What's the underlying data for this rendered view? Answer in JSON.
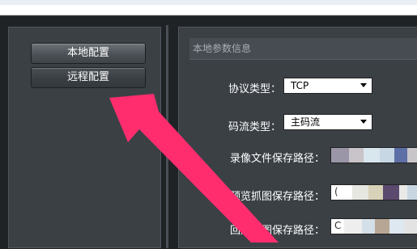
{
  "left_nav": {
    "items": [
      {
        "label": "本地配置"
      },
      {
        "label": "远程配置"
      }
    ]
  },
  "section": {
    "title": "本地参数信息"
  },
  "fields": {
    "protocol": {
      "label": "协议类型：",
      "value": "TCP"
    },
    "stream": {
      "label": "码流类型：",
      "value": "主码流"
    },
    "record_path": {
      "label": "录像文件保存路径："
    },
    "preview_path": {
      "label": "预览抓图保存路径：",
      "prefix": "("
    },
    "playback_path": {
      "label": "回放抓图保存路径：",
      "prefix": "C"
    }
  },
  "colors": {
    "accent_arrow": "#ff2d6e",
    "panel": "#3b4045",
    "background": "#1f2326"
  },
  "icons": {
    "select_caret": "chevron-down-icon",
    "annotation": "arrow-annotation"
  }
}
